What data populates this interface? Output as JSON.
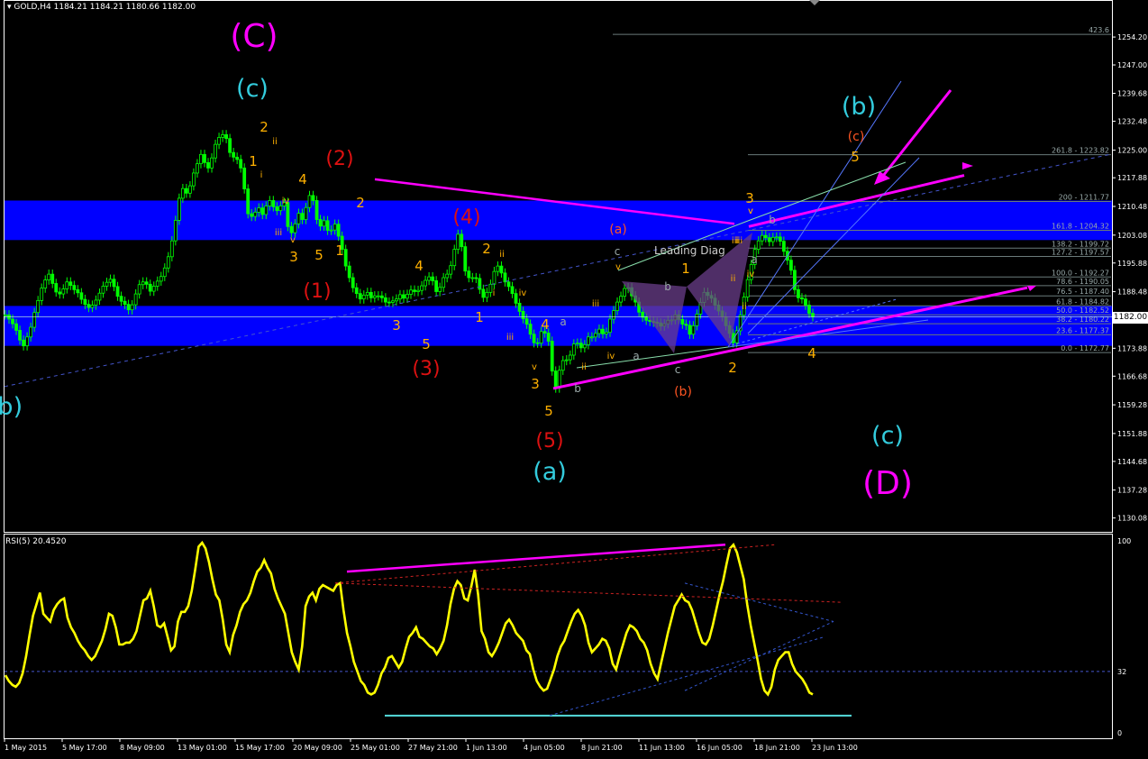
{
  "header": {
    "main_title": "GOLD,H4  1184.21 1184.21 1180.66 1182.00",
    "rsi_title": "RSI(5) 20.4520"
  },
  "colors": {
    "background": "#000000",
    "candle": "#00ff00",
    "zone": "#0000ff",
    "rsi_line": "#ffff00",
    "magenta": "#ff00ff",
    "cyan": "#33ccdd",
    "orange": "#ffb000",
    "red": "#dd1111",
    "fib_line": "#6a7a7a",
    "current_price": "#ffffff"
  },
  "axis": {
    "price_ticks": [
      "1254.20",
      "1247.00",
      "1239.68",
      "1232.48",
      "1225.00",
      "1217.88",
      "1210.48",
      "1203.08",
      "1195.88",
      "1188.48",
      "1181.28",
      "1173.88",
      "1166.68",
      "1159.28",
      "1151.88",
      "1144.68",
      "1137.28",
      "1130.08"
    ],
    "rsi_ticks": [
      "100",
      "32",
      "0"
    ],
    "time_ticks": [
      "1 May 2015",
      "5 May 17:00",
      "8 May 09:00",
      "13 May 01:00",
      "15 May 17:00",
      "20 May 09:00",
      "25 May 01:00",
      "27 May 21:00",
      "1 Jun 13:00",
      "4 Jun 05:00",
      "8 Jun 21:00",
      "11 Jun 13:00",
      "16 Jun 05:00",
      "18 Jun 21:00",
      "23 Jun 13:00"
    ],
    "current_price": "1182.00",
    "price_range": [
      1126.5,
      1260.5
    ]
  },
  "fib_levels": [
    {
      "label": "423.6",
      "price": 1254.9
    },
    {
      "label": "261.8 - 1223.82",
      "price": 1223.82
    },
    {
      "label": "200 - 1211.77",
      "price": 1211.77
    },
    {
      "label": "161.8 - 1204.32",
      "price": 1204.32
    },
    {
      "label": "138.2 - 1199.72",
      "price": 1199.72
    },
    {
      "label": "127.2 - 1197.57",
      "price": 1197.57
    },
    {
      "label": "100.0 - 1192.27",
      "price": 1192.27
    },
    {
      "label": "78.6 - 1190.05",
      "price": 1190.05
    },
    {
      "label": "76.5 - 1187.40",
      "price": 1187.4
    },
    {
      "label": "61.8 - 1184.82",
      "price": 1184.82
    },
    {
      "label": "50.0 - 1182.52",
      "price": 1182.52
    },
    {
      "label": "38.2 - 1180.22",
      "price": 1180.22
    },
    {
      "label": "23.6 - 1177.37",
      "price": 1177.37
    },
    {
      "label": "0.0 - 1172.77",
      "price": 1172.77
    }
  ],
  "zones": [
    {
      "from": 1201.8,
      "to": 1212.0
    },
    {
      "from": 1174.5,
      "to": 1184.8
    }
  ],
  "annotations": {
    "leading_diag": "Leading Diag",
    "wave_labels": [
      {
        "t": "(C)",
        "c": "magenta",
        "s": 36
      },
      {
        "t": "(c)",
        "c": "cyan",
        "s": 27
      },
      {
        "t": "(b)",
        "c": "cyan",
        "s": 27
      },
      {
        "t": "(2)",
        "c": "red",
        "s": 22
      },
      {
        "t": "(1)",
        "c": "red",
        "s": 22
      },
      {
        "t": "(3)",
        "c": "red",
        "s": 22
      },
      {
        "t": "(4)",
        "c": "red",
        "s": 22
      },
      {
        "t": "(5)",
        "c": "red",
        "s": 22
      },
      {
        "t": "(a)",
        "c": "cyan",
        "s": 27
      },
      {
        "t": "(b)",
        "c": "cyan",
        "s": 27
      },
      {
        "t": "(c)",
        "c": "cyan",
        "s": 27
      },
      {
        "t": "(D)",
        "c": "magenta",
        "s": 36
      },
      {
        "t": "(a)",
        "c": "orangered",
        "s": 14
      },
      {
        "t": "(b)",
        "c": "orangered",
        "s": 14
      },
      {
        "t": "(c)",
        "c": "orangered",
        "s": 14
      },
      {
        "t": "2",
        "c": "orange",
        "s": 15
      },
      {
        "t": "1",
        "c": "orange",
        "s": 15
      },
      {
        "t": "3",
        "c": "orange",
        "s": 15
      },
      {
        "t": "4",
        "c": "orange",
        "s": 15
      },
      {
        "t": "5",
        "c": "orange",
        "s": 15
      },
      {
        "t": "1",
        "c": "orange",
        "s": 15
      },
      {
        "t": "2",
        "c": "orange",
        "s": 15
      },
      {
        "t": "3",
        "c": "orange",
        "s": 15
      },
      {
        "t": "4",
        "c": "orange",
        "s": 15
      },
      {
        "t": "5",
        "c": "orange",
        "s": 15
      },
      {
        "t": "1",
        "c": "orange",
        "s": 15
      },
      {
        "t": "2",
        "c": "orange",
        "s": 15
      },
      {
        "t": "4",
        "c": "orange",
        "s": 15
      },
      {
        "t": "3",
        "c": "orange",
        "s": 15
      },
      {
        "t": "5",
        "c": "orange",
        "s": 15
      },
      {
        "t": "1",
        "c": "orange",
        "s": 15
      },
      {
        "t": "2",
        "c": "orange",
        "s": 15
      },
      {
        "t": "3",
        "c": "orange",
        "s": 15
      },
      {
        "t": "5",
        "c": "orange",
        "s": 15
      },
      {
        "t": "4",
        "c": "orange",
        "s": 15
      },
      {
        "t": "ii",
        "c": "orange",
        "s": 10
      },
      {
        "t": "i",
        "c": "orange",
        "s": 10
      },
      {
        "t": "iv",
        "c": "orange",
        "s": 10
      },
      {
        "t": "iii",
        "c": "orange",
        "s": 10
      },
      {
        "t": "v",
        "c": "orange",
        "s": 10
      },
      {
        "t": "ii",
        "c": "orange",
        "s": 10
      },
      {
        "t": "iv",
        "c": "orange",
        "s": 10
      },
      {
        "t": "i",
        "c": "orange",
        "s": 10
      },
      {
        "t": "iii",
        "c": "orange",
        "s": 10
      },
      {
        "t": "v",
        "c": "orange",
        "s": 10
      },
      {
        "t": "iii",
        "c": "orange",
        "s": 10
      },
      {
        "t": "v",
        "c": "orange",
        "s": 10
      },
      {
        "t": "ii",
        "c": "orange",
        "s": 10
      },
      {
        "t": "iv",
        "c": "orange",
        "s": 10
      },
      {
        "t": "i",
        "c": "orange",
        "s": 10
      },
      {
        "t": "iii",
        "c": "orange",
        "s": 10
      },
      {
        "t": "v",
        "c": "orange",
        "s": 10
      },
      {
        "t": "iv",
        "c": "orange",
        "s": 10
      },
      {
        "t": "ii",
        "c": "orange",
        "s": 10
      },
      {
        "t": "i",
        "c": "orange",
        "s": 10
      },
      {
        "t": "iii",
        "c": "orange",
        "s": 10
      },
      {
        "t": "v",
        "c": "orange",
        "s": 10
      },
      {
        "t": "a",
        "c": "gray",
        "s": 12
      },
      {
        "t": "b",
        "c": "gray",
        "s": 12
      },
      {
        "t": "c",
        "c": "gray",
        "s": 12
      },
      {
        "t": "a",
        "c": "gray",
        "s": 12
      },
      {
        "t": "b",
        "c": "gray",
        "s": 12
      },
      {
        "t": "c",
        "c": "gray",
        "s": 12
      },
      {
        "t": "a",
        "c": "gray",
        "s": 12
      },
      {
        "t": "b",
        "c": "gray",
        "s": 12
      }
    ]
  },
  "chart_data": {
    "type": "line",
    "ylim": [
      1126.5,
      1260.5
    ],
    "candles_close": [
      1182.5,
      1181.4,
      1180.2,
      1178.5,
      1176.0,
      1174.5,
      1176.8,
      1179.3,
      1183.1,
      1186.2,
      1189.4,
      1191.5,
      1193.0,
      1190.6,
      1188.4,
      1187.9,
      1189.2,
      1191.0,
      1190.1,
      1189.0,
      1188.2,
      1186.5,
      1185.2,
      1184.4,
      1185.0,
      1186.3,
      1188.1,
      1189.9,
      1190.9,
      1191.7,
      1189.8,
      1187.3,
      1186.0,
      1185.2,
      1183.8,
      1185.1,
      1187.9,
      1190.3,
      1191.0,
      1190.4,
      1188.6,
      1189.9,
      1191.2,
      1192.4,
      1194.6,
      1197.5,
      1201.6,
      1206.9,
      1212.6,
      1215.1,
      1213.9,
      1215.8,
      1219.1,
      1221.5,
      1223.9,
      1221.8,
      1220.4,
      1223.0,
      1226.5,
      1228.3,
      1229.0,
      1228.0,
      1224.4,
      1223.2,
      1222.6,
      1220.4,
      1215.0,
      1208.6,
      1207.9,
      1209.0,
      1210.1,
      1208.4,
      1210.6,
      1212.0,
      1210.4,
      1209.4,
      1210.6,
      1211.5,
      1205.3,
      1203.7,
      1206.0,
      1208.7,
      1207.1,
      1210.2,
      1213.3,
      1212.0,
      1207.1,
      1205.4,
      1206.8,
      1204.3,
      1204.4,
      1205.9,
      1202.8,
      1199.4,
      1195.1,
      1192.1,
      1189.5,
      1188.0,
      1186.6,
      1187.6,
      1188.3,
      1186.9,
      1187.4,
      1187.4,
      1186.9,
      1185.8,
      1185.7,
      1186.1,
      1186.6,
      1187.7,
      1186.8,
      1187.8,
      1188.9,
      1188.5,
      1188.8,
      1190.0,
      1191.4,
      1192.3,
      1191.3,
      1188.5,
      1189.6,
      1192.1,
      1193.0,
      1195.2,
      1199.4,
      1203.3,
      1200.1,
      1193.8,
      1192.1,
      1192.1,
      1191.9,
      1189.1,
      1187.0,
      1188.3,
      1190.4,
      1193.7,
      1195.1,
      1193.3,
      1191.0,
      1189.8,
      1188.0,
      1185.5,
      1183.4,
      1181.5,
      1180.1,
      1177.5,
      1175.3,
      1175.2,
      1178.2,
      1177.8,
      1175.7,
      1168.0,
      1163.6,
      1168.2,
      1170.7,
      1170.9,
      1172.1,
      1175.0,
      1175.2,
      1174.0,
      1174.8,
      1176.8,
      1176.8,
      1177.7,
      1178.8,
      1177.6,
      1178.0,
      1181.4,
      1183.6,
      1185.8,
      1187.3,
      1189.3,
      1189.5,
      1187.4,
      1185.8,
      1183.2,
      1181.9,
      1181.1,
      1180.8,
      1180.6,
      1180.4,
      1179.6,
      1180.2,
      1181.1,
      1181.2,
      1182.5,
      1181.3,
      1180.1,
      1179.8,
      1177.5,
      1179.7,
      1182.7,
      1185.7,
      1188.3,
      1187.5,
      1186.8,
      1185.0,
      1183.5,
      1182.0,
      1179.7,
      1177.7,
      1175.3,
      1178.4,
      1182.4,
      1187.1,
      1191.6,
      1195.5,
      1199.4,
      1201.6,
      1203.0,
      1202.4,
      1201.4,
      1202.5,
      1202.6,
      1201.5,
      1198.9,
      1196.6,
      1194.0,
      1189.0,
      1186.9,
      1186.6,
      1185.0,
      1182.9,
      1182.0
    ],
    "rsi_values": [
      30,
      27,
      25,
      24,
      26,
      31,
      40,
      51,
      61,
      67,
      73,
      62,
      60,
      58,
      64,
      67,
      69,
      70,
      60,
      55,
      52,
      48,
      45,
      43,
      40,
      38,
      40,
      44,
      48,
      54,
      62,
      61,
      55,
      46,
      46,
      47,
      47,
      49,
      53,
      61,
      69,
      70,
      74,
      66,
      56,
      55,
      57,
      50,
      43,
      45,
      58,
      63,
      63,
      66,
      74,
      85,
      97,
      99,
      96,
      89,
      80,
      72,
      69,
      59,
      46,
      42,
      51,
      56,
      63,
      67,
      69,
      73,
      79,
      84,
      86,
      90,
      86,
      83,
      75,
      70,
      66,
      62,
      52,
      42,
      37,
      33,
      45,
      66,
      71,
      73,
      69,
      75,
      77,
      76,
      75,
      74,
      77,
      78,
      64,
      52,
      45,
      37,
      32,
      27,
      25,
      21,
      20,
      21,
      25,
      31,
      34,
      39,
      40,
      37,
      34,
      37,
      44,
      50,
      52,
      55,
      50,
      49,
      47,
      45,
      44,
      41,
      44,
      48,
      56,
      67,
      75,
      79,
      77,
      70,
      69,
      76,
      85,
      72,
      53,
      49,
      42,
      40,
      43,
      47,
      52,
      57,
      59,
      56,
      52,
      50,
      48,
      43,
      41,
      33,
      27,
      24,
      22,
      23,
      28,
      33,
      40,
      45,
      48,
      53,
      58,
      62,
      64,
      61,
      56,
      47,
      42,
      44,
      46,
      49,
      48,
      44,
      36,
      33,
      40,
      46,
      52,
      56,
      55,
      53,
      49,
      47,
      43,
      36,
      31,
      28,
      36,
      44,
      52,
      59,
      66,
      69,
      72,
      69,
      68,
      64,
      58,
      52,
      47,
      46,
      49,
      56,
      64,
      72,
      79,
      88,
      96,
      98,
      94,
      87,
      80,
      67,
      56,
      47,
      38,
      28,
      22,
      20,
      24,
      33,
      38,
      40,
      42,
      42,
      36,
      32,
      30,
      28,
      25,
      21,
      20
    ]
  }
}
